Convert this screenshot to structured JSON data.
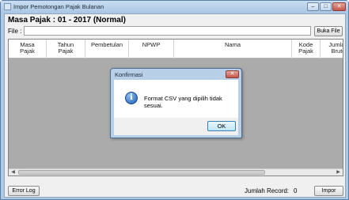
{
  "window": {
    "title": "Impor Pemotongan Pajak Bulanan",
    "icon": "app-icon",
    "controls": {
      "minimize": "–",
      "maximize": "□",
      "close": "✕"
    }
  },
  "header": {
    "heading": "Masa Pajak :  01 - 2017 (Normal)"
  },
  "file": {
    "label": "File :",
    "value": "",
    "browse_label": "Buka File"
  },
  "grid": {
    "columns": [
      {
        "label": "Masa\nPajak"
      },
      {
        "label": "Tahun\nPajak"
      },
      {
        "label": "Pembetulan"
      },
      {
        "label": "NPWP"
      },
      {
        "label": "Nama"
      },
      {
        "label": "Kode\nPajak"
      },
      {
        "label": "Jumlah\nBruto"
      }
    ],
    "rows": []
  },
  "footer": {
    "error_log_label": "Error Log",
    "record_label": "Jumlah Record:",
    "record_count": "0",
    "import_label": "Impor"
  },
  "dialog": {
    "title": "Konfirmasi",
    "icon": "info-icon",
    "message": "Format CSV yang dipilih tidak sesuai.",
    "ok_label": "OK"
  }
}
